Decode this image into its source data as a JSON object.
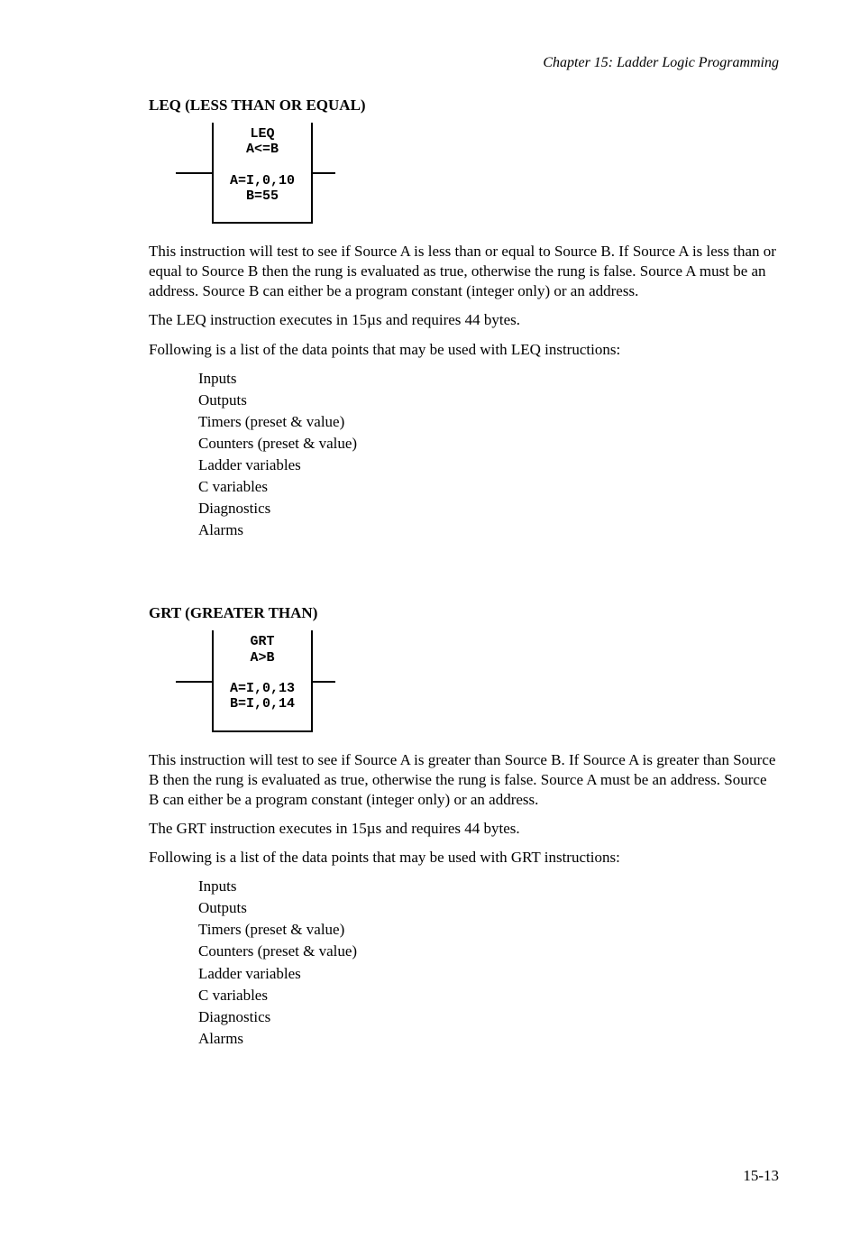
{
  "header": {
    "chapter": "Chapter 15: Ladder Logic Programming"
  },
  "sections": [
    {
      "heading": "LEQ   (LESS THAN OR EQUAL)",
      "diagram": "LEQ\nA<=B\n\nA=I,0,10\nB=55",
      "p1": "This instruction will test to see if Source A is less than or equal to Source B. If Source A is less than or equal to Source B then the rung is evaluated as true, otherwise the rung is false. Source A must be an address. Source B can either be a program constant (integer only) or an address.",
      "p2": "The LEQ instruction executes in 15µs and requires 44 bytes.",
      "p3": "Following is a list of the data points that may be used with LEQ instructions:",
      "dp": [
        "Inputs",
        "Outputs",
        "Timers (preset & value)",
        "Counters (preset & value)",
        "Ladder variables",
        "C variables",
        "Diagnostics",
        "Alarms"
      ]
    },
    {
      "heading": "GRT   (GREATER THAN)",
      "diagram": "GRT\nA>B\n\nA=I,0,13\nB=I,0,14",
      "p1": "This instruction will test to see if Source A is greater than Source B. If Source A is greater than Source B then the rung is evaluated as true, otherwise the rung is false. Source A must be an address. Source B can either be a program constant (integer only) or an address.",
      "p2": "The GRT instruction executes in 15µs and requires 44 bytes.",
      "p3": "Following is a list of the data points that may be used with GRT instructions:",
      "dp": [
        "Inputs",
        "Outputs",
        "Timers (preset & value)",
        "Counters (preset & value)",
        "Ladder variables",
        "C variables",
        "Diagnostics",
        "Alarms"
      ]
    }
  ],
  "page": "15-13"
}
